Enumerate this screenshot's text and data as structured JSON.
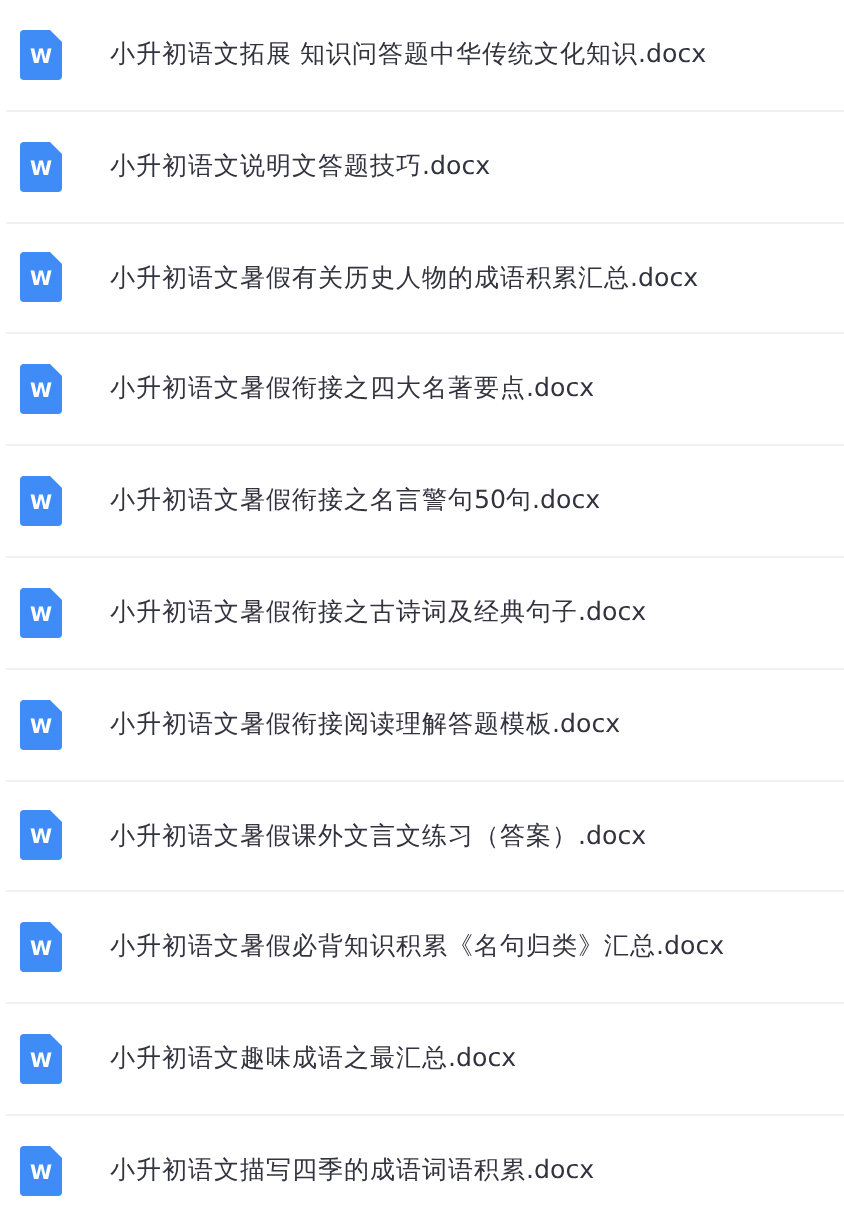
{
  "files": [
    {
      "icon_text": "W",
      "name": "小升初语文拓展 知识问答题中华传统文化知识.docx"
    },
    {
      "icon_text": "W",
      "name": "小升初语文说明文答题技巧.docx"
    },
    {
      "icon_text": "W",
      "name": "小升初语文暑假有关历史人物的成语积累汇总.docx"
    },
    {
      "icon_text": "W",
      "name": "小升初语文暑假衔接之四大名著要点.docx"
    },
    {
      "icon_text": "W",
      "name": "小升初语文暑假衔接之名言警句50句.docx"
    },
    {
      "icon_text": "W",
      "name": "小升初语文暑假衔接之古诗词及经典句子.docx"
    },
    {
      "icon_text": "W",
      "name": "小升初语文暑假衔接阅读理解答题模板.docx"
    },
    {
      "icon_text": "W",
      "name": "小升初语文暑假课外文言文练习（答案）.docx"
    },
    {
      "icon_text": "W",
      "name": "小升初语文暑假必背知识积累《名句归类》汇总.docx"
    },
    {
      "icon_text": "W",
      "name": "小升初语文趣味成语之最汇总.docx"
    },
    {
      "icon_text": "W",
      "name": "小升初语文描写四季的成语词语积累.docx"
    }
  ]
}
